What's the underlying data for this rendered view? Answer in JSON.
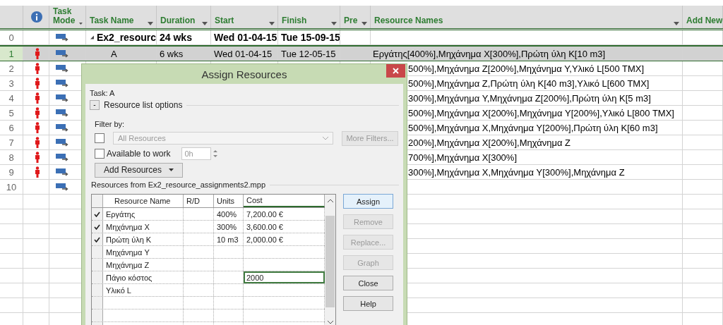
{
  "grid": {
    "columns": [
      {
        "kind": "rownum"
      },
      {
        "kind": "info"
      },
      {
        "kind": "text",
        "label": "Task Mode",
        "dropdown": true
      },
      {
        "kind": "text",
        "label": "Task Name",
        "dropdown": true
      },
      {
        "kind": "text",
        "label": "Duration",
        "dropdown": true
      },
      {
        "kind": "text",
        "label": "Start",
        "dropdown": true
      },
      {
        "kind": "text",
        "label": "Finish",
        "dropdown": true
      },
      {
        "kind": "text",
        "label": "Pre",
        "dropdown": true
      },
      {
        "kind": "text",
        "label": "Resource Names",
        "dropdown": true
      },
      {
        "kind": "text",
        "label": "Add New"
      }
    ],
    "rows": [
      {
        "id": "0",
        "kind": "summary",
        "selected": false,
        "indicator": false,
        "name": "Ex2_resourc",
        "duration": "24 wks",
        "start": "Wed 01-04-15",
        "finish": "Tue 15-09-15"
      },
      {
        "id": "1",
        "kind": "task",
        "selected": true,
        "indicator": true,
        "name": "A",
        "duration": "6 wks",
        "start": "Wed 01-04-15",
        "finish": "Tue 12-05-15",
        "resources": "Εργάτης[400%],Μηχάνημα X[300%],Πρώτη ύλη K[10 m3]"
      },
      {
        "id": "2",
        "kind": "task",
        "selected": false,
        "indicator": true,
        "resources": "500%],Μηχάνημα Z[200%],Μηχάνημα Y,Υλικό L[500 TMX]"
      },
      {
        "id": "3",
        "kind": "task",
        "selected": false,
        "indicator": true,
        "resources": "500%],Μηχάνημα Z,Πρώτη ύλη K[40 m3],Υλικό L[600 TMX]"
      },
      {
        "id": "4",
        "kind": "task",
        "selected": false,
        "indicator": true,
        "resources": "300%],Μηχάνημα Y,Μηχάνημα Z[200%],Πρώτη ύλη K[5 m3]"
      },
      {
        "id": "5",
        "kind": "task",
        "selected": false,
        "indicator": true,
        "resources": "500%],Μηχάνημα X[200%],Μηχάνημα Y[200%],Υλικό L[800 TMX]"
      },
      {
        "id": "6",
        "kind": "task",
        "selected": false,
        "indicator": true,
        "resources": "500%],Μηχάνημα X,Μηχάνημα Y[200%],Πρώτη ύλη K[60 m3]"
      },
      {
        "id": "7",
        "kind": "task",
        "selected": false,
        "indicator": true,
        "resources": "200%],Μηχάνημα X[200%],Μηχάνημα Z"
      },
      {
        "id": "8",
        "kind": "task",
        "selected": false,
        "indicator": true,
        "resources": "700%],Μηχάνημα X[300%]"
      },
      {
        "id": "9",
        "kind": "task",
        "selected": false,
        "indicator": true,
        "resources": "300%],Μηχάνημα X,Μηχάνημα Y[300%],Μηχάνημα Z"
      },
      {
        "id": "10",
        "kind": "task",
        "selected": false,
        "indicator": false
      }
    ]
  },
  "dialog": {
    "title": "Assign Resources",
    "task": "Task: A",
    "options_toggle": "-",
    "options_label": "Resource list options",
    "filter_label": "Filter by:",
    "filter_checked": false,
    "filter_value": "All Resources",
    "more_filters": "More Filters...",
    "available_label": "Available to work",
    "available_checked": false,
    "available_value": "0h",
    "add_resources": "Add Resources",
    "resources_label": "Resources from Ex2_resource_assignments2.mpp",
    "table": {
      "columns": [
        "Resource Name",
        "R/D",
        "Units",
        "Cost"
      ],
      "rows": [
        {
          "checked": true,
          "editing": false,
          "name": "Εργάτης",
          "units": "400%",
          "cost": "7,200.00 €"
        },
        {
          "checked": true,
          "editing": false,
          "name": "Μηχάνημα X",
          "units": "300%",
          "cost": "3,600.00 €"
        },
        {
          "checked": true,
          "editing": false,
          "name": "Πρώτη ύλη K",
          "units": "10 m3",
          "cost": "2,000.00 €"
        },
        {
          "checked": false,
          "editing": false,
          "name": "Μηχάνημα Y"
        },
        {
          "checked": false,
          "editing": false,
          "name": "Μηχάνημα Z"
        },
        {
          "checked": false,
          "editing": true,
          "name": "Πάγιο κόστος",
          "cost": "2000"
        },
        {
          "checked": false,
          "editing": false,
          "name": "Υλικό L"
        }
      ]
    },
    "buttons": [
      {
        "label": "Assign",
        "disabled": false,
        "default": true
      },
      {
        "label": "Remove",
        "disabled": true,
        "default": false
      },
      {
        "label": "Replace...",
        "disabled": true,
        "default": false
      },
      {
        "label": "Graph",
        "disabled": true,
        "default": false
      },
      {
        "label": "Close",
        "disabled": false,
        "default": false
      },
      {
        "label": "Help",
        "disabled": false,
        "default": false
      }
    ]
  }
}
